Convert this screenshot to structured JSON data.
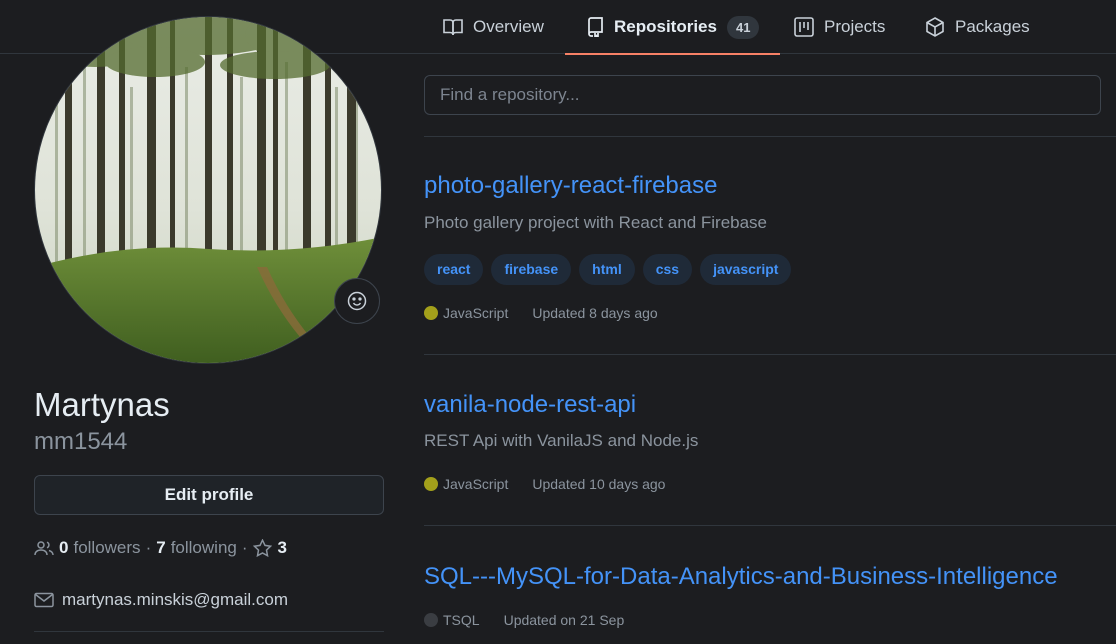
{
  "tabs": [
    {
      "label": "Overview",
      "icon": "book-icon"
    },
    {
      "label": "Repositories",
      "icon": "repo-icon",
      "count": "41"
    },
    {
      "label": "Projects",
      "icon": "project-icon"
    },
    {
      "label": "Packages",
      "icon": "package-icon"
    }
  ],
  "profile": {
    "name": "Martynas",
    "login": "mm1544",
    "edit_label": "Edit profile",
    "followers_count": "0",
    "followers_label": "followers",
    "following_count": "7",
    "following_label": "following",
    "stars_count": "3",
    "email": "martynas.minskis@gmail.com"
  },
  "search": {
    "placeholder": "Find a repository..."
  },
  "repos": [
    {
      "name": "photo-gallery-react-firebase",
      "description": "Photo gallery project with React and Firebase",
      "topics": [
        "react",
        "firebase",
        "html",
        "css",
        "javascript"
      ],
      "language": "JavaScript",
      "language_color": "#a3a01b",
      "updated": "Updated 8 days ago"
    },
    {
      "name": "vanila-node-rest-api",
      "description": "REST Api with VanilaJS and Node.js",
      "topics": [],
      "language": "JavaScript",
      "language_color": "#a3a01b",
      "updated": "Updated 10 days ago"
    },
    {
      "name": "SQL---MySQL-for-Data-Analytics-and-Business-Intelligence",
      "description": "",
      "topics": [],
      "language": "TSQL",
      "language_color": "#3a3d42",
      "updated": "Updated on 21 Sep"
    }
  ],
  "colors": {
    "accent": "#4493f8",
    "tab_underline": "#f78166",
    "background": "#1c1d20"
  }
}
